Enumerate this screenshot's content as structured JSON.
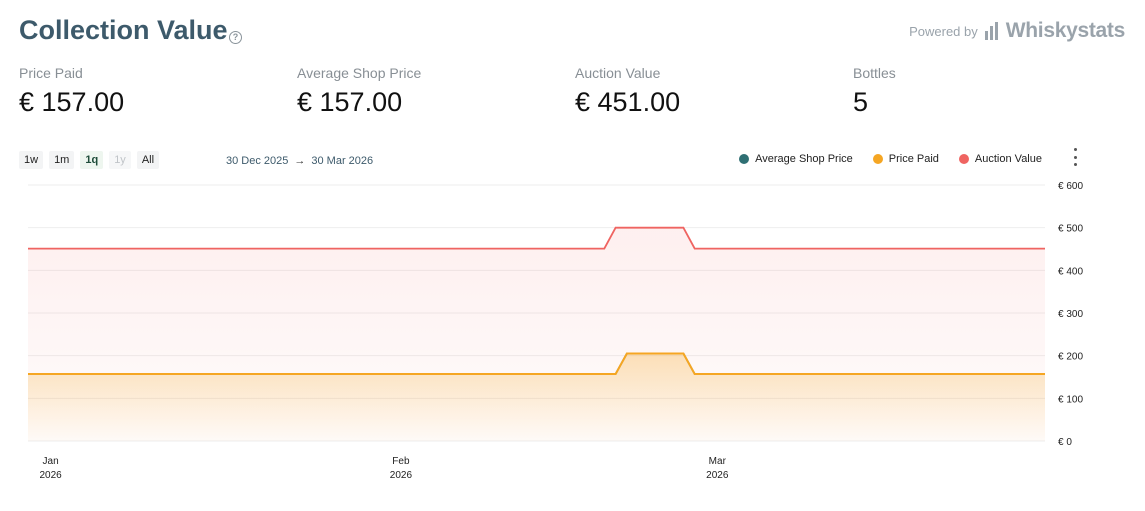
{
  "header": {
    "title": "Collection Value",
    "help_icon": "question-circle-icon",
    "powered_by": "Powered by",
    "brand": "Whiskystats",
    "brand_icon": "bar-chart-icon"
  },
  "stats": [
    {
      "label": "Price Paid",
      "value": "€ 157.00"
    },
    {
      "label": "Average Shop Price",
      "value": "€ 157.00"
    },
    {
      "label": "Auction Value",
      "value": "€ 451.00"
    },
    {
      "label": "Bottles",
      "value": "5"
    }
  ],
  "toolbar": {
    "ranges": [
      {
        "label": "1w",
        "state": "normal"
      },
      {
        "label": "1m",
        "state": "normal"
      },
      {
        "label": "1q",
        "state": "active"
      },
      {
        "label": "1y",
        "state": "disabled"
      },
      {
        "label": "All",
        "state": "normal"
      }
    ],
    "date_from": "30 Dec 2025",
    "arrow": "→",
    "date_to": "30 Mar 2026",
    "menu_icon": "more-vertical-icon"
  },
  "legend": [
    {
      "name": "Average Shop Price",
      "color": "#2f6f73"
    },
    {
      "name": "Price Paid",
      "color": "#f5a623"
    },
    {
      "name": "Auction Value",
      "color": "#ef6461"
    }
  ],
  "chart_data": {
    "type": "area",
    "x_range": [
      "2025-12-30",
      "2026-03-30"
    ],
    "ylim": [
      0,
      600
    ],
    "y_ticks": [
      0,
      100,
      200,
      300,
      400,
      500,
      600
    ],
    "y_tick_prefix": "€ ",
    "x_ticks": [
      {
        "date": "2026-01-01",
        "label": [
          "Jan",
          "2026"
        ]
      },
      {
        "date": "2026-02-01",
        "label": [
          "Feb",
          "2026"
        ]
      },
      {
        "date": "2026-03-01",
        "label": [
          "Mar",
          "2026"
        ]
      }
    ],
    "grid": true,
    "legend_position": "top-right",
    "series": [
      {
        "name": "Auction Value",
        "color": "#ef6461",
        "points": [
          [
            "2025-12-30",
            451
          ],
          [
            "2026-02-19",
            451
          ],
          [
            "2026-02-20",
            500
          ],
          [
            "2026-02-26",
            500
          ],
          [
            "2026-02-27",
            451
          ],
          [
            "2026-03-30",
            451
          ]
        ]
      },
      {
        "name": "Average Shop Price",
        "color": "#2f6f73",
        "points": [
          [
            "2025-12-30",
            157
          ],
          [
            "2026-02-20",
            157
          ],
          [
            "2026-02-21",
            205
          ],
          [
            "2026-02-26",
            205
          ],
          [
            "2026-02-27",
            157
          ],
          [
            "2026-03-30",
            157
          ]
        ]
      },
      {
        "name": "Price Paid",
        "color": "#f5a623",
        "points": [
          [
            "2025-12-30",
            157
          ],
          [
            "2026-02-20",
            157
          ],
          [
            "2026-02-21",
            205
          ],
          [
            "2026-02-26",
            205
          ],
          [
            "2026-02-27",
            157
          ],
          [
            "2026-03-30",
            157
          ]
        ]
      }
    ]
  }
}
